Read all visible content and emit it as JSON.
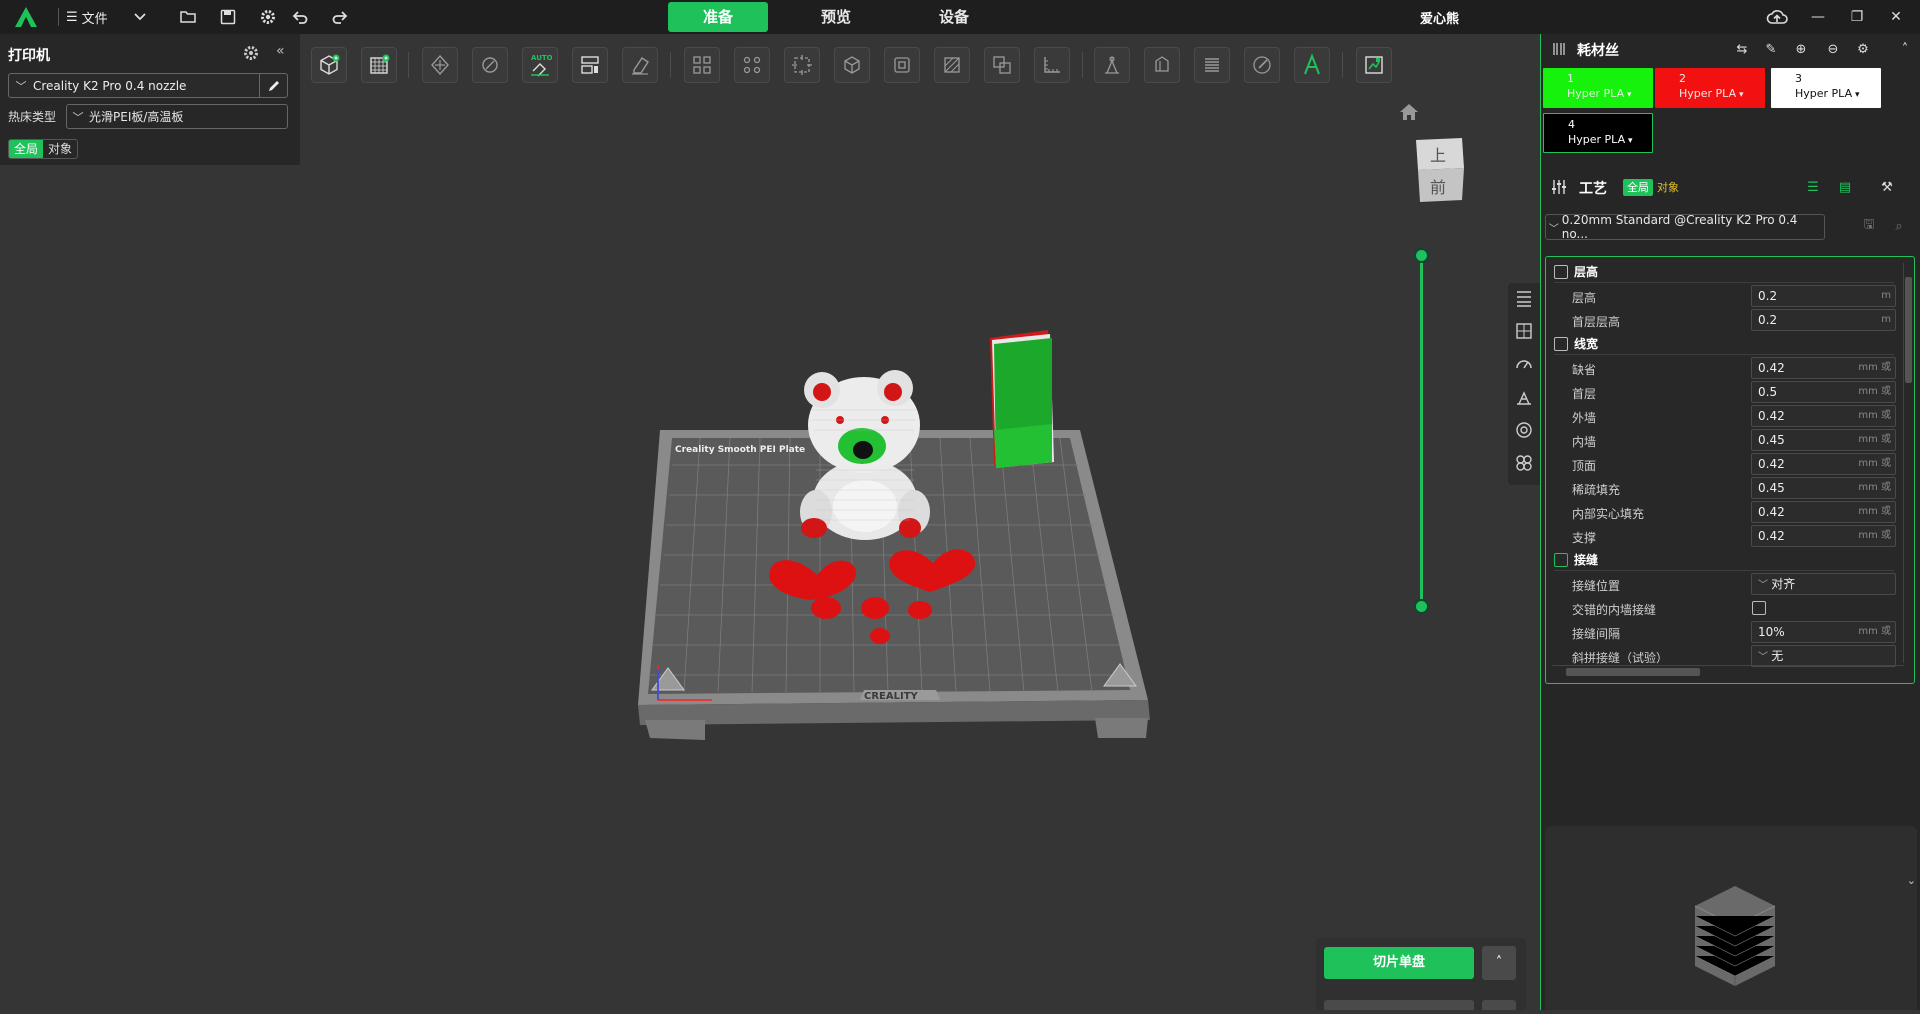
{
  "titlebar": {
    "file_label": "文件",
    "tabs": [
      "准备",
      "预览",
      "设备"
    ],
    "active_tab": 0,
    "project_name": "爱心熊",
    "accent": "#1fc15b"
  },
  "printer_panel": {
    "title": "打印机",
    "printer": "Creality K2 Pro 0.4 nozzle",
    "bed_label": "热床类型",
    "bed_value": "光滑PEI板/高温板",
    "scope_global": "全局",
    "scope_object": "对象"
  },
  "right_panel": {
    "filament_title": "耗材丝",
    "filaments": [
      {
        "num": "1",
        "material": "Hyper PLA",
        "color": "#16f20c",
        "text": "#111111"
      },
      {
        "num": "2",
        "material": "Hyper PLA",
        "color": "#f21010",
        "text": "#111111"
      },
      {
        "num": "3",
        "material": "Hyper PLA",
        "color": "#ffffff",
        "text": "#111111"
      },
      {
        "num": "4",
        "material": "Hyper PLA",
        "color": "#000000",
        "text": "#ffffff"
      }
    ],
    "process_title": "工艺",
    "scope_global": "全局",
    "scope_object": "对象",
    "preset": "0.20mm Standard @Creality K2 Pro 0.4 no...",
    "sections": {
      "layer_height": {
        "title": "层高",
        "options": [
          {
            "label": "层高",
            "value": "0.2",
            "unit": "m"
          },
          {
            "label": "首层层高",
            "value": "0.2",
            "unit": "m"
          }
        ]
      },
      "line_width": {
        "title": "线宽",
        "options": [
          {
            "label": "缺省",
            "value": "0.42",
            "unit": "mm 或"
          },
          {
            "label": "首层",
            "value": "0.5",
            "unit": "mm 或"
          },
          {
            "label": "外墙",
            "value": "0.42",
            "unit": "mm 或"
          },
          {
            "label": "内墙",
            "value": "0.45",
            "unit": "mm 或"
          },
          {
            "label": "顶面",
            "value": "0.42",
            "unit": "mm 或"
          },
          {
            "label": "稀疏填充",
            "value": "0.45",
            "unit": "mm 或"
          },
          {
            "label": "内部实心填充",
            "value": "0.42",
            "unit": "mm 或"
          },
          {
            "label": "支撑",
            "value": "0.42",
            "unit": "mm 或"
          }
        ]
      },
      "seam": {
        "title": "接缝",
        "options": [
          {
            "label": "接缝位置",
            "value": "对齐",
            "kind": "select"
          },
          {
            "label": "交错的内墙接缝",
            "kind": "checkbox"
          },
          {
            "label": "接缝间隔",
            "value": "10%",
            "unit": "mm 或"
          },
          {
            "label": "斜拼接缝（试验）",
            "value": "无",
            "kind": "select"
          }
        ]
      }
    }
  },
  "viewport": {
    "view_top": "上",
    "view_front": "前",
    "bed_brand": "CREALITY",
    "bed_plate": "Creality Smooth PEI Plate"
  },
  "slice": {
    "button": "切片单盘",
    "more": "˄"
  }
}
